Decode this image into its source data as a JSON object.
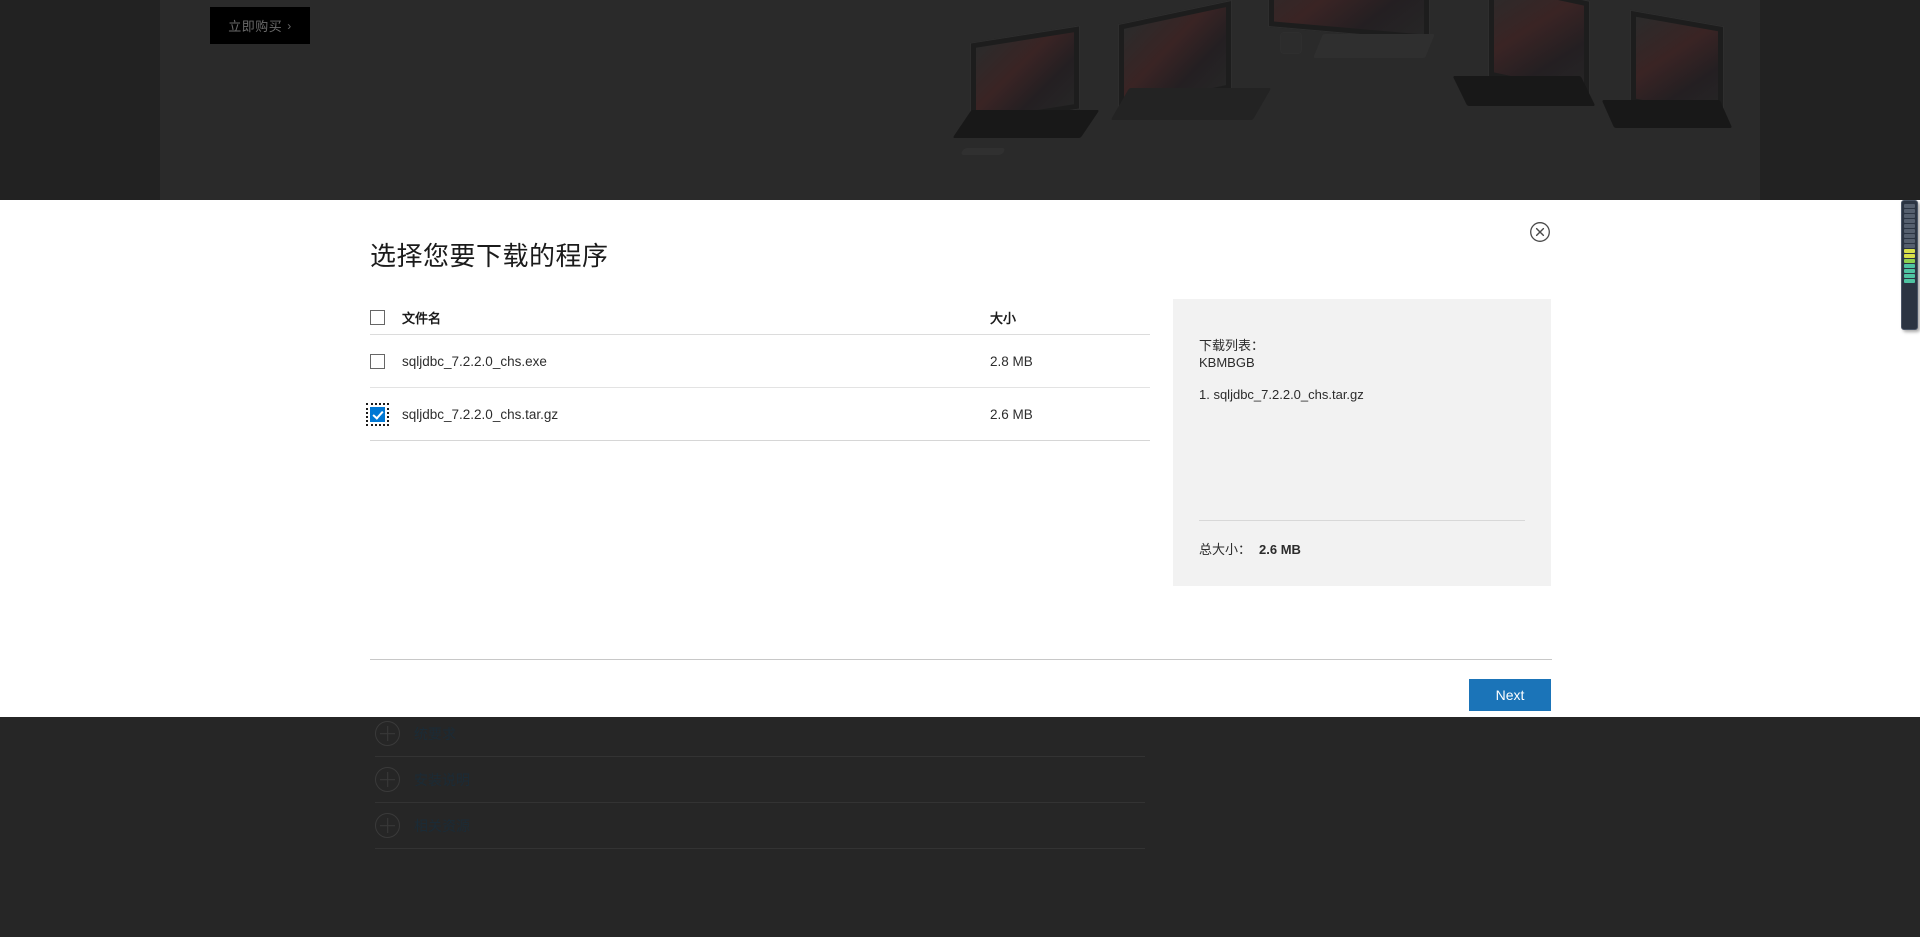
{
  "background": {
    "buy_button_label": "立即购买",
    "buy_button_chevron": "›",
    "accordion": [
      {
        "label": "统要求",
        "icon": "plus-circle-icon"
      },
      {
        "label": "安装说明",
        "icon": "plus-circle-icon"
      },
      {
        "label": "相关资源",
        "icon": "plus-circle-icon"
      }
    ]
  },
  "modal": {
    "title": "选择您要下载的程序",
    "close_icon": "close-circle-icon",
    "table": {
      "headers": {
        "name": "文件名",
        "size": "大小"
      },
      "header_checkbox_checked": false,
      "rows": [
        {
          "name": "sqljdbc_7.2.2.0_chs.exe",
          "size": "2.8 MB",
          "checked": false,
          "focused": false
        },
        {
          "name": "sqljdbc_7.2.2.0_chs.tar.gz",
          "size": "2.6 MB",
          "checked": true,
          "focused": true
        }
      ]
    },
    "summary": {
      "heading": "下载列表：",
      "units": "KBMBGB",
      "items": [
        "1. sqljdbc_7.2.2.0_chs.tar.gz"
      ],
      "total_label": "总大小：",
      "total_value": "2.6 MB"
    },
    "next_button_label": "Next"
  },
  "colors": {
    "accent_blue": "#1b74b8",
    "checkbox_blue": "#0078d4",
    "panel_gray": "#f2f2f2",
    "page_dark": "#262626"
  },
  "meter": {
    "segments": [
      "#555f6e",
      "#555f6e",
      "#555f6e",
      "#555f6e",
      "#555f6e",
      "#555f6e",
      "#555f6e",
      "#555f6e",
      "#555f6e",
      "#d8e04a",
      "#d8e04a",
      "#8fd14f",
      "#4fc3a1",
      "#4fc3a1",
      "#4fc3a1",
      "#4fc3a1"
    ]
  }
}
